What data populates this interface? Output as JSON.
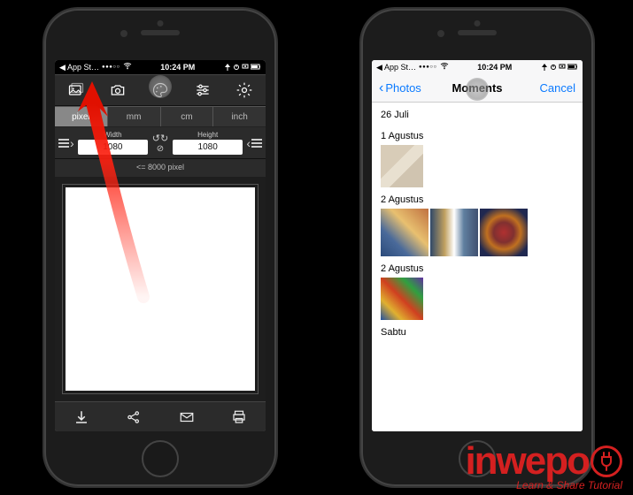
{
  "status": {
    "back": "App St…",
    "time": "10:24 PM"
  },
  "left_app": {
    "units": [
      "pixel",
      "mm",
      "cm",
      "inch"
    ],
    "active_unit": 0,
    "width_label": "Width",
    "height_label": "Height",
    "width_value": "1080",
    "height_value": "1080",
    "max_note": "<= 8000 pixel",
    "top_icons": [
      "gallery",
      "camera",
      "palette",
      "sliders",
      "gear"
    ],
    "bottom_icons": [
      "download",
      "share",
      "mail",
      "print"
    ]
  },
  "right_app": {
    "back_label": "Photos",
    "title": "Moments",
    "cancel_label": "Cancel",
    "sections": [
      {
        "label": "26 Juli",
        "thumbs": []
      },
      {
        "label": "1 Agustus",
        "thumbs": [
          "doc"
        ]
      },
      {
        "label": "2 Agustus",
        "thumbs": [
          "crowd1",
          "crowd2",
          "rug"
        ]
      },
      {
        "label": "2 Agustus",
        "thumbs": [
          "mix"
        ]
      },
      {
        "label": "Sabtu",
        "thumbs": []
      }
    ]
  },
  "watermark": {
    "brand": "inwepo",
    "tagline": "Learn & Share Tutorial"
  }
}
